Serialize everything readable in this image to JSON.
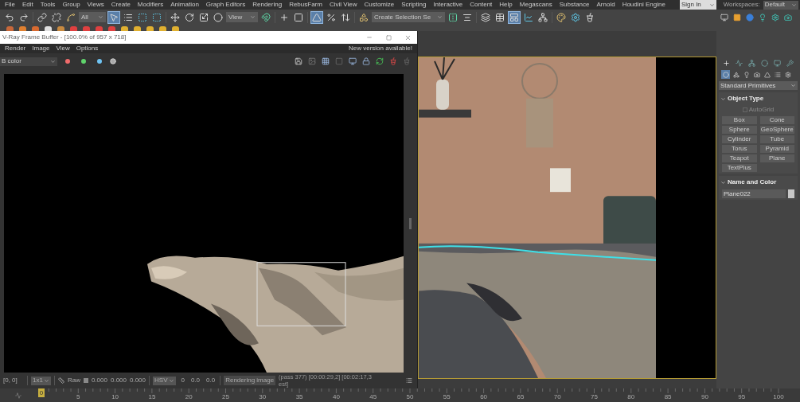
{
  "menu_bar": {
    "items": [
      "File",
      "Edit",
      "Tools",
      "Group",
      "Views",
      "Create",
      "Modifiers",
      "Animation",
      "Graph Editors",
      "Rendering",
      "RebusFarm",
      "Civil View",
      "Customize",
      "Scripting",
      "Interactive",
      "Content",
      "Help",
      "Megascans",
      "Substance",
      "Arnold",
      "Houdini Engine"
    ],
    "sign_in": "Sign In",
    "workspaces_label": "Workspaces:",
    "workspace": "Default"
  },
  "main_toolbar": {
    "selection_filter": "All",
    "reference_coord": "View",
    "named_selection": "Create Selection Se",
    "tools": [
      {
        "selected": false
      },
      {
        "selected": false
      },
      {
        "selected": false
      },
      {
        "selected": false
      },
      {
        "selected": false
      },
      {
        "selected": true
      },
      {
        "selected": false
      },
      {
        "selected": false
      },
      {
        "selected": false
      },
      {
        "selected": false
      },
      {
        "selected": false
      },
      {
        "selected": false
      },
      {
        "selected": false
      },
      {
        "selected": false
      },
      {
        "selected": false
      },
      {
        "selected": false
      },
      {
        "selected": true
      },
      {
        "selected": false
      },
      {
        "selected": false
      },
      {
        "selected": false
      },
      {
        "selected": false
      },
      {
        "selected": false
      },
      {
        "selected": false
      },
      {
        "selected": false
      },
      {
        "selected": true
      },
      {
        "selected": false
      },
      {
        "selected": false
      },
      {
        "selected": false
      },
      {
        "selected": false
      },
      {
        "selected": false
      }
    ]
  },
  "frame_buffer": {
    "title": "V-Ray Frame Buffer - [100.0% of 957 x 718]",
    "menu": [
      "Render",
      "Image",
      "View",
      "Options"
    ],
    "notice": "New version available!",
    "channel": "B color",
    "channel_buttons": [
      {
        "color": "#f06b6b"
      },
      {
        "color": "#5fd36b"
      },
      {
        "color": "#6fc3f2"
      }
    ],
    "status": {
      "coords": "[0, 0]",
      "zoom": "1x1",
      "raw_label": "Raw",
      "values": [
        "0.000",
        "0.000",
        "0.000"
      ],
      "color_mode": "HSV",
      "hsv_values": [
        "0",
        "0.0",
        "0.0"
      ],
      "progress_label": "Rendering image",
      "progress_text": "(pass 377) [00:00:29,2] [00:02:17,3 est]"
    }
  },
  "command_panel": {
    "tabs": [
      {
        "selected": false
      },
      {
        "selected": false
      },
      {
        "selected": false
      },
      {
        "selected": false
      },
      {
        "selected": false
      },
      {
        "selected": false
      }
    ],
    "categories": [
      {
        "selected": true
      },
      {
        "selected": false
      },
      {
        "selected": false
      },
      {
        "selected": false
      },
      {
        "selected": false
      },
      {
        "selected": false
      },
      {
        "selected": false
      }
    ],
    "dropdown": "Standard Primitives",
    "object_type": {
      "title": "Object Type",
      "expanded": true,
      "autogrid": {
        "label": "AutoGrid",
        "checked": false,
        "disabled": true
      },
      "buttons": [
        "Box",
        "Cone",
        "Sphere",
        "GeoSphere",
        "Cylinder",
        "Tube",
        "Torus",
        "Pyramid",
        "Teapot",
        "Plane",
        "TextPlus"
      ]
    },
    "name_and_color": {
      "title": "Name and Color",
      "expanded": true,
      "name": "Plane022"
    }
  },
  "timeline": {
    "current_frame": "0",
    "level": 0,
    "labels": [
      "5",
      "10",
      "15",
      "20",
      "25",
      "30",
      "35",
      "40",
      "45",
      "50",
      "55",
      "60",
      "65",
      "70",
      "75",
      "80",
      "85",
      "90",
      "95",
      "100"
    ]
  }
}
